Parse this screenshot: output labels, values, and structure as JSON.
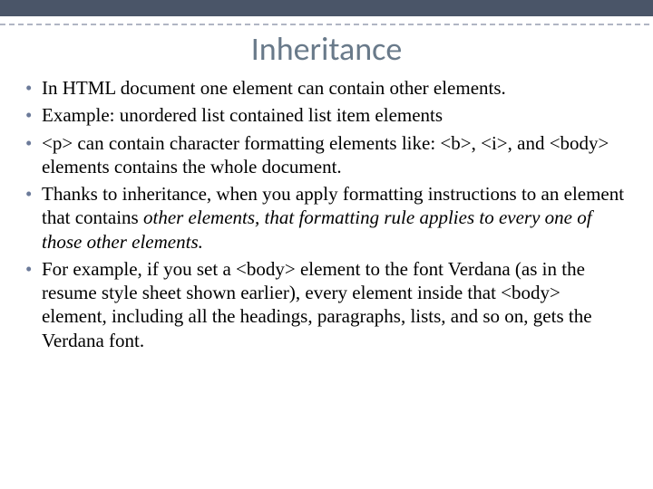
{
  "title": "Inheritance",
  "bullets": [
    {
      "pre": "In HTML document one element can contain other elements.",
      "italic": "",
      "post": ""
    },
    {
      "pre": "Example: unordered list contained list item elements",
      "italic": "",
      "post": ""
    },
    {
      "pre": "<p> can contain character formatting elements like: <b>, <i>, and <body> elements contains the whole document.",
      "italic": "",
      "post": ""
    },
    {
      "pre": "Thanks to inheritance, when you apply formatting instructions to an element that contains ",
      "italic": "other elements, that formatting rule applies to every one of those other elements.",
      "post": ""
    },
    {
      "pre": "For example, if you set a <body> element to the font Verdana (as in the resume style sheet shown earlier), every element inside that <body> element, including all the headings, paragraphs, lists, and so on, gets the Verdana font.",
      "italic": "",
      "post": ""
    }
  ]
}
